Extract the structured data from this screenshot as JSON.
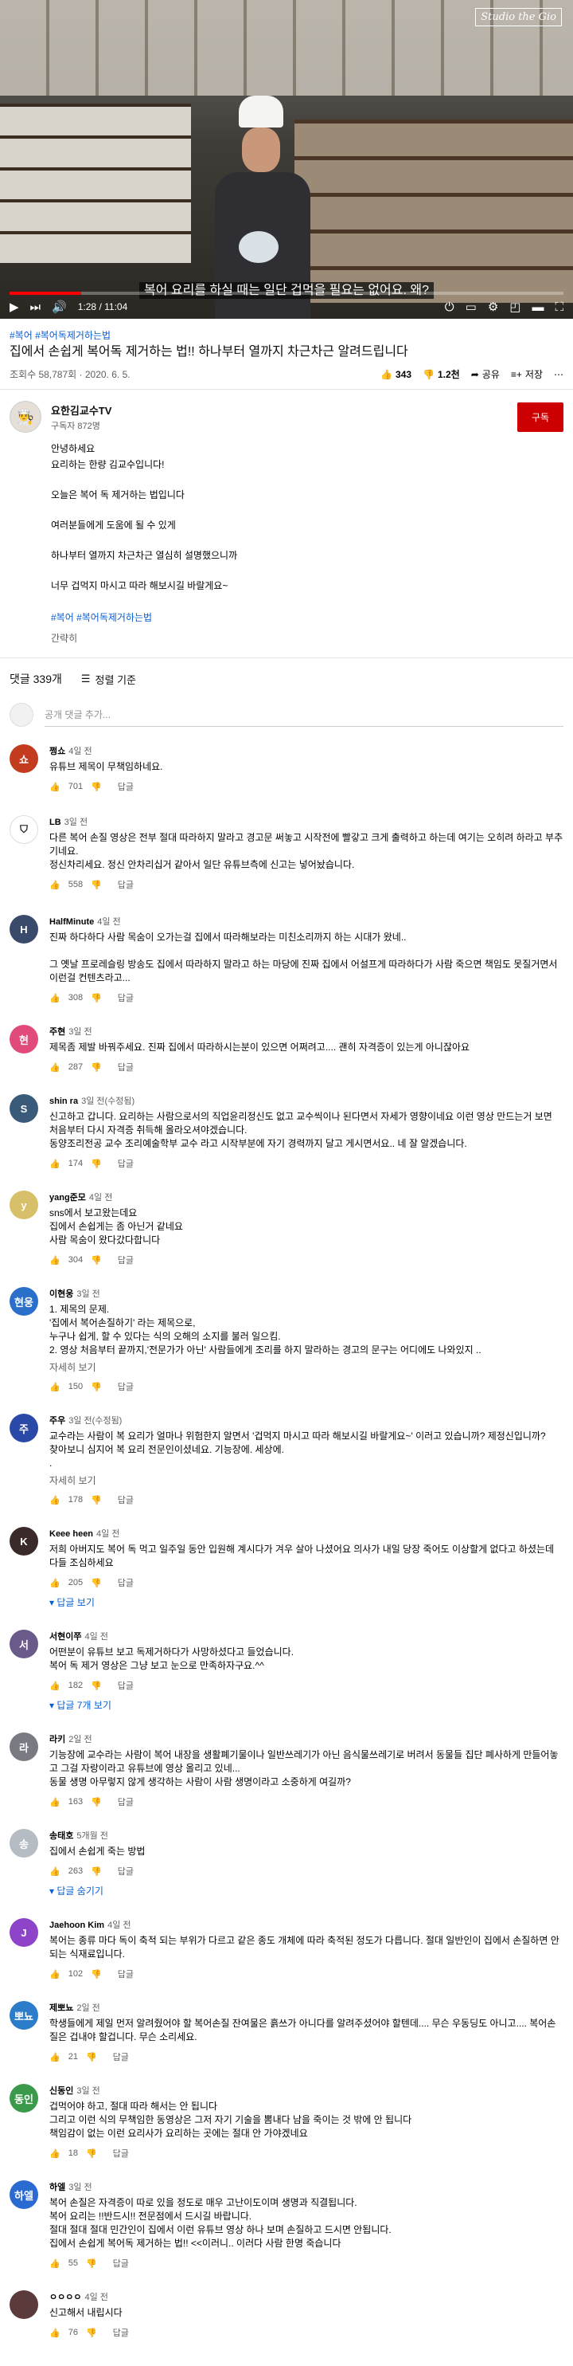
{
  "player": {
    "watermark": "Studio the Gio",
    "subtitle": "복어 요리를 하실 때는 일단 겁먹을 필요는 없어요. 왜?",
    "time": "1:28 / 11:04",
    "progress": 0.13
  },
  "video": {
    "hashtags": "#복어 #복어독제거하는법",
    "title": "집에서 손쉽게 복어독 제거하는 법!! 하나부터 열까지 차근차근 알려드립니다",
    "views": "조회수 58,787회 · 2020. 6. 5.",
    "likes": "343",
    "dislikes": "1.2천",
    "share": "공유",
    "save": "저장"
  },
  "channel": {
    "name": "요한김교수TV",
    "subs": "구독자 872명",
    "subscribe": "구독"
  },
  "description": {
    "lines": [
      "안녕하세요\n요리하는 한량 김교수입니다!",
      "오늘은 복어 독 제거하는 법입니다",
      "여러분들에게 도움에 될 수 있게",
      "하나부터 열까지 차근차근 열심히 설명했으니까",
      "너무 겁먹지 마시고 따라 해보시길 바랄게요~"
    ],
    "tags": "#복어 #복어독제거하는법",
    "less": "간략히"
  },
  "comments_header": {
    "count": "댓글 339개",
    "sort": "정렬 기준"
  },
  "add_comment": "공개 댓글 추가...",
  "reply_label": "답글",
  "comments": [
    {
      "initial": "쇼",
      "color": "#c43c1f",
      "author": "쩡쇼",
      "when": "4일 전",
      "text": "유튜브 제목이 무책임하네요.",
      "likes": "701",
      "more": "",
      "replies": ""
    },
    {
      "initial": "⛉",
      "color": "#ffffff",
      "author": "LB",
      "when": "3일 전",
      "text": "다른 복어 손질 영상은 전부 절대 따라하지 말라고 경고문 써놓고 시작전에 빨갛고 크게 출력하고 하는데 여기는 오히려 하라고 부추기네요.\n정신차리세요. 정신 안차리십거 같아서 일단 유튜브측에 신고는 넣어놨습니다.",
      "likes": "558",
      "more": "",
      "replies": ""
    },
    {
      "initial": "H",
      "color": "#3a4a6b",
      "author": "HalfMinute",
      "when": "4일 전",
      "text": "진짜 하다하다 사람 목숨이 오가는걸 집에서 따라해보라는 미친소리까지 하는 시대가 왔네..\n\n그 옛날 프로레슬링 방송도 집에서 따라하지 말라고 하는 마당에 진짜 집에서 어설프게 따라하다가 사람 죽으면 책임도 못질거면서 이런걸 컨텐츠라고...",
      "likes": "308",
      "more": "",
      "replies": ""
    },
    {
      "initial": "현",
      "color": "#e04b7a",
      "author": "주현",
      "when": "3일 전",
      "text": "제목좀 제발 바꿔주세요. 진짜 집에서 따라하시는분이 있으면 어쩌려고.... 괜히 자격증이 있는게 아니잖아요",
      "likes": "287",
      "more": "",
      "replies": ""
    },
    {
      "initial": "S",
      "color": "#3a5a7a",
      "author": "shin ra",
      "when": "3일 전(수정됨)",
      "text": "신고하고 갑니다. 요리하는 사람으로서의 직업윤리정신도 없고 교수씩이나 된다면서 자세가 영향이네요 이런 영상 만드는거 보면 처음부터 다시 자격증 취득해 올라오셔야겠습니다.\n동양조리전공 교수 조리예술학부 교수 라고 시작부분에 자기 경력까지 달고 게시면서요.. 네 잘 알겠습니다.",
      "likes": "174",
      "more": "",
      "replies": ""
    },
    {
      "initial": "y",
      "color": "#d8c06a",
      "author": "yang준모",
      "when": "4일 전",
      "text": "sns에서 보고왔는데요\n집에서 손쉽게는 좀 아닌거 같네요\n사람 목숨이 왔다갔다합니다",
      "likes": "304",
      "more": "",
      "replies": ""
    },
    {
      "initial": "현웅",
      "color": "#2a6fc9",
      "author": "이현웅",
      "when": "3일 전",
      "text": "1. 제목의 문제.\n'집에서 복어손질하기' 라는 제목으로,\n누구나 쉽게, 할 수 있다는 식의 오해의 소지를 불러 일으킴.\n2. 영상 처음부터 끝까지,'전문가가 아닌' 사람들에게 조리를 하지 말라하는 경고의 문구는 어디에도 나와있지 ..",
      "likes": "150",
      "more": "자세히 보기",
      "replies": ""
    },
    {
      "initial": "주",
      "color": "#2b4aa8",
      "author": "주우",
      "when": "3일 전(수정됨)",
      "text": "교수라는 사람이 복 요리가 얼마나 위험한지 알면서 '겁먹지 마시고 따라 해보시길 바랄게요~' 이러고 있습니까? 제정신입니까?\n찾아보니 심지어 복 요리 전문인이셨네요. 기능장에. 세상에.\n.",
      "likes": "178",
      "more": "자세히 보기",
      "replies": ""
    },
    {
      "initial": "K",
      "color": "#3a2a2a",
      "author": "Keee heen",
      "when": "4일 전",
      "text": "저희 아버지도 복어 독 먹고 일주일 동안 입원해 계시다가 겨우 살아 나셨어요 의사가 내일 당장 죽어도 이상할게 없다고 하셨는데 다들 조심하세요",
      "likes": "205",
      "more": "",
      "replies": "답글 보기"
    },
    {
      "initial": "서",
      "color": "#6a5a8a",
      "author": "서현이쭈",
      "when": "4일 전",
      "text": "어떤분이 유튜브 보고 독제거하다가 사망하셨다고 들었습니다.\n복어 독 제거 영상은 그냥 보고 눈으로 만족하자구요.^^",
      "likes": "182",
      "more": "",
      "replies": "답글 7개 보기"
    },
    {
      "initial": "라",
      "color": "#7a7a82",
      "author": "라키",
      "when": "2일 전",
      "text": "기능장에 교수라는 사람이 복어 내장을 생활폐기물이나 일반쓰레기가 아닌 음식물쓰레기로 버려서 동물들 집단 폐사하게 만들어놓고 그걸 자랑이라고 유튜브에 영상 올리고 있네...\n동물 생명 아무렇지 않게 생각하는 사람이 사람 생명이라고 소중하게 여길까?",
      "likes": "163",
      "more": "",
      "replies": ""
    },
    {
      "initial": "송",
      "color": "#b5bcc4",
      "author": "송태호",
      "when": "5개월 전",
      "text": "집에서 손쉽게 죽는 방법",
      "likes": "263",
      "more": "",
      "replies": "답글 숨기기"
    },
    {
      "initial": "J",
      "color": "#8e44c9",
      "author": "Jaehoon Kim",
      "when": "4일 전",
      "text": "복어는 종류 마다 독이 축적 되는 부위가 다르고 같은 종도 개체에 따라 축적된 정도가 다릅니다. 절대 일반인이 집에서 손질하면 안 되는 식재료입니다.",
      "likes": "102",
      "more": "",
      "replies": ""
    },
    {
      "initial": "뽀뇨",
      "color": "#2b7cc9",
      "author": "제뽀뇨",
      "when": "2일 전",
      "text": "학생들에게 제일 먼저 알려줬어야 할 복어손질 잔여물은 흙쓰가 아니다를 알려주셨어야 할텐데.... 무슨 우동딩도 아니고.... 복어손질은 겁내야 할겁니다. 무슨 소리세요.",
      "likes": "21",
      "more": "",
      "replies": ""
    },
    {
      "initial": "동인",
      "color": "#3a9a4a",
      "author": "신동인",
      "when": "3일 전",
      "text": "겁먹어야 하고, 절대 따라 해서는 안 됩니다\n그리고 이런 식의 무책임한 동영상은 그저 자기 기술을 뽐내다 남을 죽이는 것 밖에 안 됩니다\n책임감이 없는 이런 요리사가 요리하는 곳에는 절대 안 가야겠네요",
      "likes": "18",
      "more": "",
      "replies": ""
    },
    {
      "initial": "하엘",
      "color": "#2b6ad0",
      "author": "하엘",
      "when": "3일 전",
      "text": "복어 손질은 자격증이 따로 있을 정도로 매우 고난이도이며 생명과 직결됩니다.\n복어 요리는 !!반드시!! 전문점에서 드시길 바랍니다.\n절대 절대 절대 민간인이 집에서 이런 유튜브 영상 하나 보며 손질하고 드시면 안됩니다.\n집에서 손쉽게 복어독 제거하는 법!! <<이러니.. 이러다 사람 한명 죽습니다",
      "likes": "55",
      "more": "",
      "replies": ""
    },
    {
      "initial": "",
      "color": "#5a3a3a",
      "author": "ㅇㅇㅇㅇ",
      "when": "4일 전",
      "text": "신고해서 내립시다",
      "likes": "76",
      "more": "",
      "replies": ""
    }
  ]
}
